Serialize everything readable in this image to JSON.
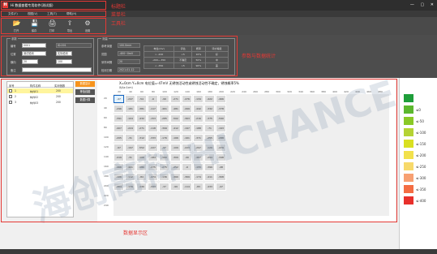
{
  "window": {
    "app_icon": "H",
    "title": "Hi 数据查看专用软件(测试版)",
    "controls": [
      "—",
      "▢",
      "✕"
    ]
  },
  "menu": [
    "文件(F)",
    "视图(V)",
    "工具(T)",
    "帮助(H)"
  ],
  "toolbar": [
    {
      "icon": "folder-icon",
      "glyph": "📂",
      "label": "打开"
    },
    {
      "icon": "save-icon",
      "glyph": "💾",
      "label": "保存"
    },
    {
      "icon": "print-icon",
      "glyph": "🖨",
      "label": "打印"
    },
    {
      "icon": "export-icon",
      "glyph": "⇪",
      "label": "导出"
    },
    {
      "icon": "settings-icon",
      "glyph": "⚙",
      "label": "设置"
    }
  ],
  "params": {
    "group1_title": "参数",
    "fields": [
      {
        "label": "编号",
        "value": "0001"
      },
      {
        "label": "位置",
        "value": "测试检测"
      },
      {
        "label": "横向",
        "value": "20"
      },
      {
        "label": "备注",
        "value": ""
      }
    ],
    "extra_inputs": [
      "ID-001",
      "实际检测",
      "100"
    ],
    "group2_title": "测量",
    "meas_labels": [
      "参考深度",
      "范围",
      "采样间隔",
      "检测日期"
    ],
    "meas_values": [
      "100.0mm",
      "-400~0mV",
      "20",
      "2021-01-12"
    ],
    "mini_table": [
      [
        "电位(mV)",
        "评估",
        "概率",
        "评价等级"
      ],
      [
        "> -200",
        "<5",
        "10%",
        "好"
      ],
      [
        "-200~-350",
        "不确定",
        "50%",
        "中"
      ],
      [
        "< -350",
        ">5",
        "90%",
        "差"
      ]
    ]
  },
  "list": {
    "headers": [
      "序号",
      "构件名称",
      "实测值数"
    ],
    "rows": [
      {
        "no": "1",
        "name": "构件01",
        "count": "200",
        "selected": true
      },
      {
        "no": "2",
        "name": "构件02",
        "count": "200",
        "selected": false
      },
      {
        "no": "3",
        "name": "构件03",
        "count": "200",
        "selected": false
      }
    ]
  },
  "side_buttons": [
    {
      "label": "数据显示",
      "active": true
    },
    {
      "label": "等值线图",
      "active": false
    },
    {
      "label": "数据计算",
      "active": false
    }
  ],
  "data_view": {
    "title": "X=0cm  Y=0cm  电位值=-47mV  无锈蚀活动性或锈蚀活动性不确定，锈蚀概率5%",
    "subtitle": "X(Δx:1cm)",
    "col_labels": [
      "20",
      "40",
      "60",
      "80",
      "100",
      "120",
      "140",
      "160",
      "180",
      "200",
      "220",
      "240",
      "260",
      "280",
      "300",
      "320",
      "340",
      "360",
      "380",
      "400",
      "420",
      "440",
      "460",
      "480"
    ],
    "row_labels": [
      "20",
      "40",
      "60",
      "80",
      "100",
      "120",
      "140",
      "160",
      "180",
      "200",
      "220",
      "240"
    ],
    "grid": [
      [
        "-47",
        "-247",
        "-54",
        "-6",
        "-99",
        "-271",
        "-476",
        "-134",
        "-422",
        "-466"
      ],
      [
        "-296",
        "-181",
        "-381",
        "-117",
        "-461",
        "-481",
        "-499",
        "-442",
        "-332",
        "-378"
      ],
      [
        "-391",
        "-104",
        "-432",
        "-153",
        "-285",
        "-502",
        "-363",
        "-216",
        "-375",
        "-590"
      ],
      [
        "-407",
        "-224",
        "-271",
        "-118",
        "-399",
        "-412",
        "-197",
        "-188",
        "-71",
        "-193"
      ],
      [
        "-205",
        "-31",
        "-312",
        "-333",
        "-176",
        "-166",
        "-161",
        "-371",
        "-255",
        "-288"
      ],
      [
        "-97",
        "-197",
        "-552",
        "-227",
        "-97",
        "-109",
        "-223",
        "-297",
        "-129",
        "-479"
      ],
      [
        "-419",
        "-31",
        "-106",
        "-184",
        "-160",
        "-309",
        "-40",
        "-467",
        "-294",
        "-348"
      ],
      [
        "-466",
        "-401",
        "-180",
        "-275",
        "-275",
        "-252",
        "-6",
        "-155",
        "-399",
        "-48"
      ],
      [
        "-106",
        "-112",
        "-84",
        "-474",
        "-136",
        "-360",
        "-369",
        "-174",
        "-411",
        "-308"
      ],
      [
        "-464",
        "-179",
        "-130",
        "-333",
        "-37",
        "-99",
        "-114",
        "-83",
        "-433",
        "-47"
      ]
    ]
  },
  "legend": [
    {
      "color": "#1e9e3a",
      "label": ""
    },
    {
      "color": "#5cb82e",
      "label": "≤0"
    },
    {
      "color": "#8ac926",
      "label": "≤-50"
    },
    {
      "color": "#b5d334",
      "label": "≤-100"
    },
    {
      "color": "#d9e021",
      "label": "≤-150"
    },
    {
      "color": "#f2e14c",
      "label": "≤-200"
    },
    {
      "color": "#f7d96b",
      "label": "≤-250"
    },
    {
      "color": "#f7a072",
      "label": "≤-300"
    },
    {
      "color": "#f46d43",
      "label": "≤-350"
    },
    {
      "color": "#e8302b",
      "label": "≤-400"
    }
  ],
  "annotations": {
    "title_bar": "标题栏",
    "menu_bar": "菜单栏",
    "tool_bar": "工具栏",
    "params": "参数与数据统计",
    "data": "数据显示区"
  },
  "watermark": "海创高科 HICHANCE"
}
